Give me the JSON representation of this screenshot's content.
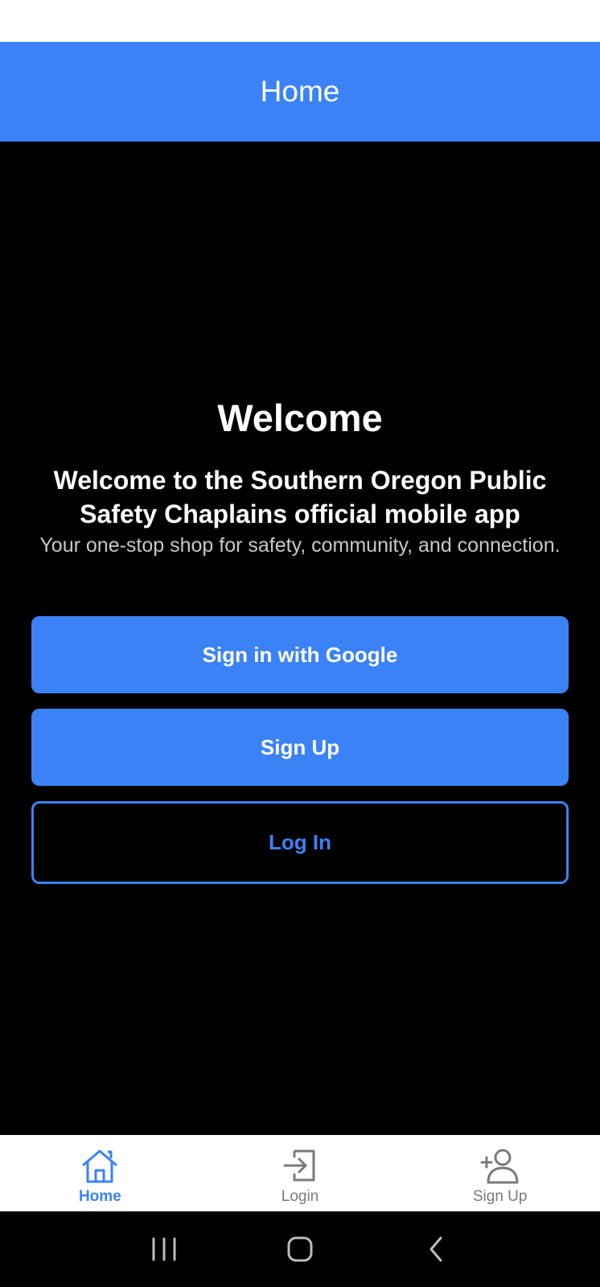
{
  "header": {
    "title": "Home"
  },
  "main": {
    "heading": "Welcome",
    "subheading": "Welcome to the Southern Oregon Public Safety Chaplains official mobile app",
    "tagline": "Your one-stop shop for safety, community, and connection.",
    "buttons": {
      "google": "Sign in with Google",
      "signup": "Sign Up",
      "login": "Log In"
    }
  },
  "tabs": [
    {
      "label": "Home",
      "icon": "home-icon",
      "active": true
    },
    {
      "label": "Login",
      "icon": "login-icon",
      "active": false
    },
    {
      "label": "Sign Up",
      "icon": "add-user-icon",
      "active": false
    }
  ],
  "colors": {
    "accent": "#3b82f6",
    "background": "#000000",
    "tab_inactive": "#7a7a7a"
  }
}
